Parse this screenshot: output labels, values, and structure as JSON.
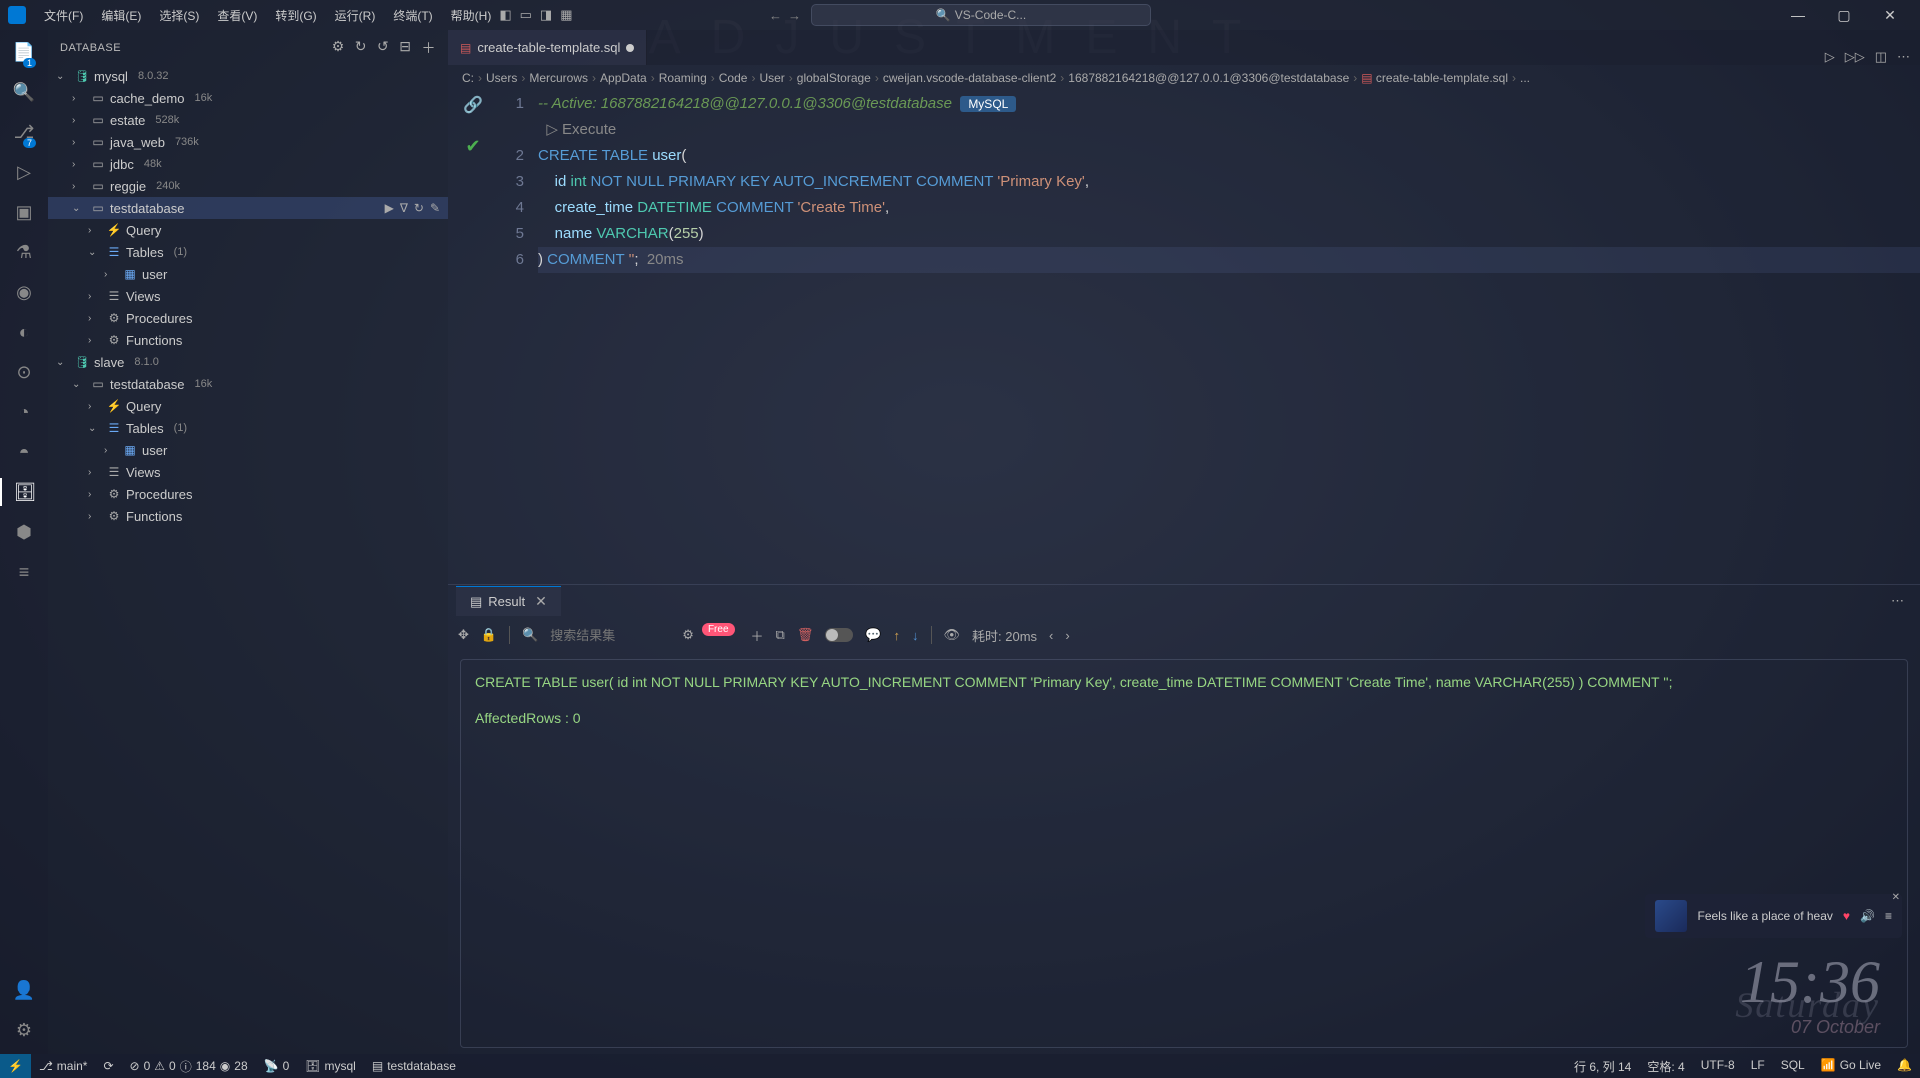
{
  "watermark": "ADJUSTMENT",
  "menu": [
    "文件(F)",
    "编辑(E)",
    "选择(S)",
    "查看(V)",
    "转到(G)",
    "运行(R)",
    "终端(T)",
    "帮助(H)"
  ],
  "search_placeholder": "VS-Code-C...",
  "activity_badges": {
    "explorer": "1",
    "scm": "7"
  },
  "sidebar": {
    "title": "DATABASE",
    "conn1": {
      "name": "mysql",
      "ver": "8.0.32"
    },
    "dbs1": [
      {
        "name": "cache_demo",
        "meta": "16k"
      },
      {
        "name": "estate",
        "meta": "528k"
      },
      {
        "name": "java_web",
        "meta": "736k"
      },
      {
        "name": "jdbc",
        "meta": "48k"
      },
      {
        "name": "reggie",
        "meta": "240k"
      }
    ],
    "testdb": "testdatabase",
    "testdb_children": [
      {
        "name": "Query",
        "ico": "⚡",
        "cls": "ico-sch-y"
      },
      {
        "name": "Tables",
        "meta": "(1)",
        "ico": "☰",
        "cls": "ico-tbl",
        "expanded": true
      },
      {
        "name": "Views",
        "ico": "☰",
        "cls": "ico-sch"
      },
      {
        "name": "Procedures",
        "ico": "⚙",
        "cls": "ico-gear"
      },
      {
        "name": "Functions",
        "ico": "⚙",
        "cls": "ico-gear"
      }
    ],
    "user_table": "user",
    "conn2": {
      "name": "slave",
      "ver": "8.1.0"
    },
    "slave_db": {
      "name": "testdatabase",
      "meta": "16k"
    },
    "slave_children": [
      {
        "name": "Query",
        "ico": "⚡",
        "cls": "ico-sch-y"
      },
      {
        "name": "Tables",
        "meta": "(1)",
        "ico": "☰",
        "cls": "ico-tbl",
        "expanded": true
      },
      {
        "name": "Views",
        "ico": "☰",
        "cls": "ico-sch"
      },
      {
        "name": "Procedures",
        "ico": "⚙",
        "cls": "ico-gear"
      },
      {
        "name": "Functions",
        "ico": "⚙",
        "cls": "ico-gear"
      }
    ]
  },
  "tab": {
    "name": "create-table-template.sql"
  },
  "breadcrumb": [
    "C:",
    "Users",
    "Mercurows",
    "AppData",
    "Roaming",
    "Code",
    "User",
    "globalStorage",
    "cweijan.vscode-database-client2",
    "1687882164218@@127.0.0.1@3306@testdatabase"
  ],
  "breadcrumb_file": "create-table-template.sql",
  "breadcrumb_more": "...",
  "code": {
    "active": "-- Active: 1687882164218@@127.0.0.1@3306@testdatabase",
    "mysql": "MySQL",
    "execute": "▷ Execute",
    "l2": "CREATE TABLE user(",
    "l3": "    id int NOT NULL PRIMARY KEY AUTO_INCREMENT COMMENT 'Primary Key',",
    "l4": "    create_time DATETIME COMMENT 'Create Time',",
    "l5": "    name VARCHAR(255)",
    "l6": ") COMMENT '';",
    "l6_time": "20ms"
  },
  "panel": {
    "tab": "Result",
    "search_ph": "搜索结果集",
    "badge": "Free",
    "cost": "耗时: 20ms",
    "sql": "CREATE TABLE user( id int NOT NULL PRIMARY KEY AUTO_INCREMENT COMMENT 'Primary Key', create_time DATETIME COMMENT 'Create Time', name VARCHAR(255) ) COMMENT '';",
    "affected": "AffectedRows : 0"
  },
  "status": {
    "branch": "main*",
    "sync": "⟳",
    "err": "0",
    "warn": "0",
    "info": "184",
    "hint": "28",
    "ports": "0",
    "db": "mysql",
    "schema": "testdatabase",
    "pos": "行 6, 列 14",
    "spaces": "空格: 4",
    "enc": "UTF-8",
    "eol": "LF",
    "lang": "SQL",
    "live": "Go Live"
  },
  "clock": {
    "time": "15:36",
    "day": "Saturday",
    "date": "07 October"
  },
  "music": {
    "title": "Feels like a place of heav"
  }
}
